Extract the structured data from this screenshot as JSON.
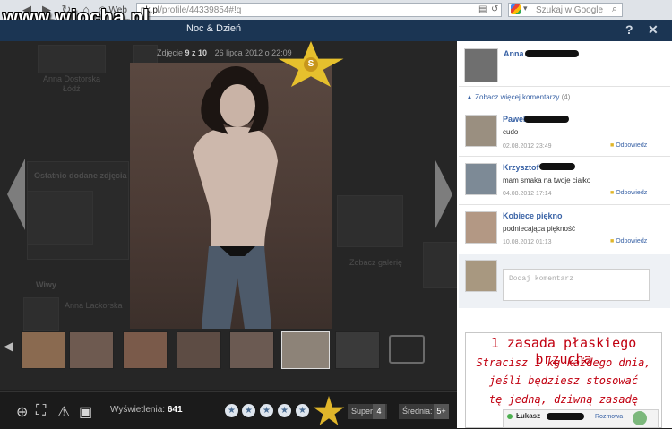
{
  "browser": {
    "tab_label": "Web",
    "url_prefix": "nk.pl",
    "url_rest": "/profile/44339854#!q",
    "google_placeholder": "Szukaj w Google",
    "watermark": "www.wiocha.pl"
  },
  "header": {
    "title": "Noc & Dzień",
    "help": "?",
    "close": "✕"
  },
  "photo_meta": {
    "label": "Zdjęcie",
    "counter": "9 z 10",
    "date": "26 lipca 2012 o 22:09"
  },
  "background_page": {
    "friend_name": "Anna Dostorska",
    "friend_sub": "Łódź",
    "recent_photos": "Ostatnio dodane zdjęcia",
    "gallery": "Zobacz galerię",
    "wall": "Wiwy",
    "wall_name": "Anna Lackorska"
  },
  "toolbar": {
    "views_label": "Wyświetlenia:",
    "views_value": "641",
    "super_label": "Super",
    "super_value": "4",
    "avg_label": "Średnia:",
    "avg_value": "5+"
  },
  "panel": {
    "owner_name": "Anna",
    "more_comments": "Zobacz więcej komentarzy",
    "more_count": "(4)",
    "comments": [
      {
        "name": "Paweł",
        "text": "cudo",
        "date": "02.08.2012 23:49",
        "reply": "Odpowiedz"
      },
      {
        "name": "Krzysztof",
        "text": "mam smaka na twoje ciałko",
        "date": "04.08.2012 17:14",
        "reply": "Odpowiedz"
      },
      {
        "name": "Kobiece piękno",
        "text": "podniecająca piękność",
        "date": "10.08.2012 01:13",
        "reply": "Odpowiedz"
      }
    ],
    "comment_placeholder": "Dodaj komentarz"
  },
  "ad": {
    "title": "1 zasada płaskiego brzucha",
    "lines": [
      "Stracisz 1 kg każdego dnia,",
      "jeśli będziesz stosować",
      "tę jedną, dziwną zasadę"
    ]
  },
  "chat": {
    "name": "Łukasz",
    "action": "Rozmowa"
  },
  "colors": {
    "header_bg": "#1b3553",
    "link": "#3a63a6",
    "ad_red": "#c10010",
    "star_gold": "#e0b62a"
  }
}
